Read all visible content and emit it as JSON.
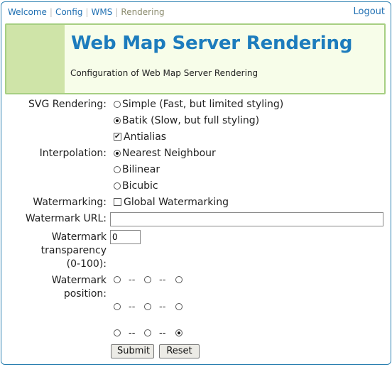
{
  "nav": {
    "items": [
      {
        "label": "Welcome"
      },
      {
        "label": "Config"
      },
      {
        "label": "WMS"
      },
      {
        "label": "Rendering"
      }
    ],
    "logout": "Logout"
  },
  "banner": {
    "title": "Web Map Server Rendering",
    "description": "Configuration of Web Map Server Rendering"
  },
  "form": {
    "svg_rendering": {
      "label": "SVG Rendering:",
      "options": [
        {
          "label": "Simple (Fast, but limited styling)",
          "selected": false
        },
        {
          "label": "Batik (Slow, but full styling)",
          "selected": true
        }
      ],
      "antialias": {
        "label": "Antialias",
        "checked": true
      }
    },
    "interpolation": {
      "label": "Interpolation:",
      "options": [
        {
          "label": "Nearest Neighbour",
          "selected": true
        },
        {
          "label": "Bilinear",
          "selected": false
        },
        {
          "label": "Bicubic",
          "selected": false
        }
      ]
    },
    "watermarking": {
      "label": "Watermarking:",
      "global": {
        "label": "Global Watermarking",
        "checked": false
      }
    },
    "watermark_url": {
      "label": "Watermark URL:",
      "value": ""
    },
    "watermark_transparency": {
      "label_line1": "Watermark",
      "label_line2": "transparency",
      "label_line3": "(0-100):",
      "value": "0"
    },
    "watermark_position": {
      "label_line1": "Watermark",
      "label_line2": "position:",
      "separator": "--",
      "selected_index": 8
    },
    "submit": "Submit",
    "reset": "Reset"
  }
}
